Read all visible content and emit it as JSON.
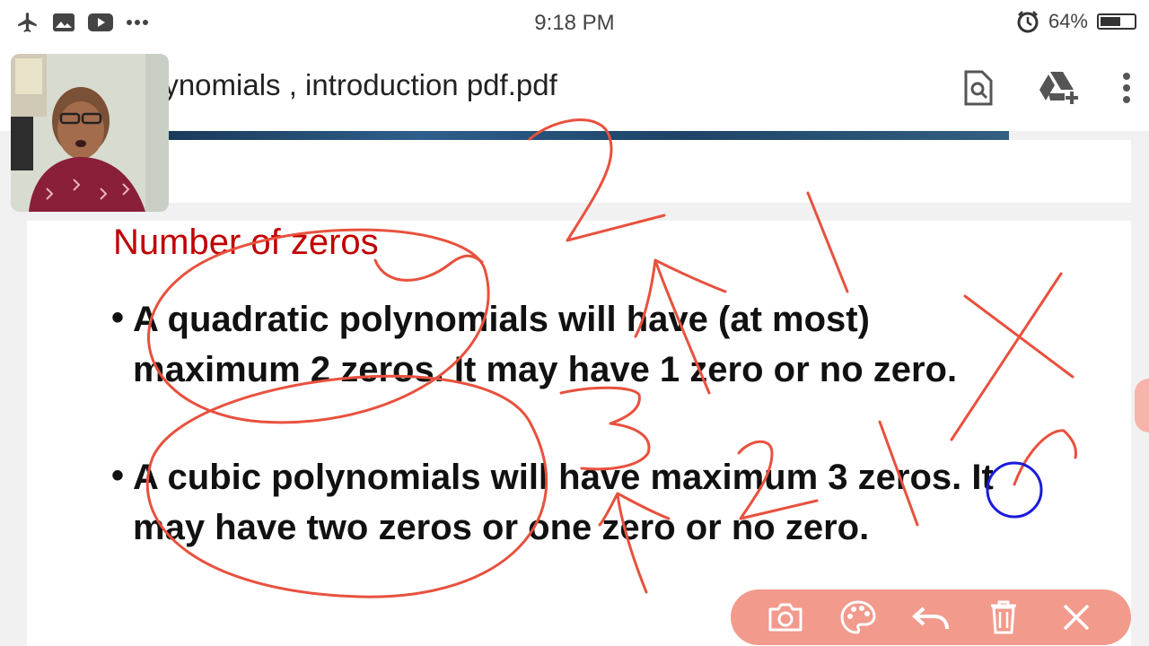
{
  "status_bar": {
    "time": "9:18 PM",
    "battery_percent": "64%",
    "battery_level": 0.64,
    "left_icons": [
      "airplane-icon",
      "image-icon",
      "youtube-icon",
      "more-dots-icon"
    ],
    "right_icons": [
      "alarm-icon",
      "battery-icon"
    ]
  },
  "app_bar": {
    "title": "lynomials , introduction pdf.pdf",
    "actions": [
      "find-in-page-icon",
      "add-to-drive-icon",
      "overflow-menu-icon"
    ]
  },
  "slide": {
    "title": "Number of zeros",
    "bullet_symbol": "•",
    "bullets": [
      "A quadratic polynomials will have  (at most) maximum 2 zeros. It may have 1 zero or no zero.",
      "A cubic polynomials will have maximum 3 zeros. It may have two zeros or one zero or no zero."
    ]
  },
  "annotation": {
    "ink_color": "#e8513e",
    "cursor_color": "#1a1adc"
  },
  "annotation_toolbar": {
    "background": "#f29a8c",
    "tools": [
      "camera-icon",
      "palette-icon",
      "undo-icon",
      "delete-icon",
      "close-icon"
    ]
  }
}
